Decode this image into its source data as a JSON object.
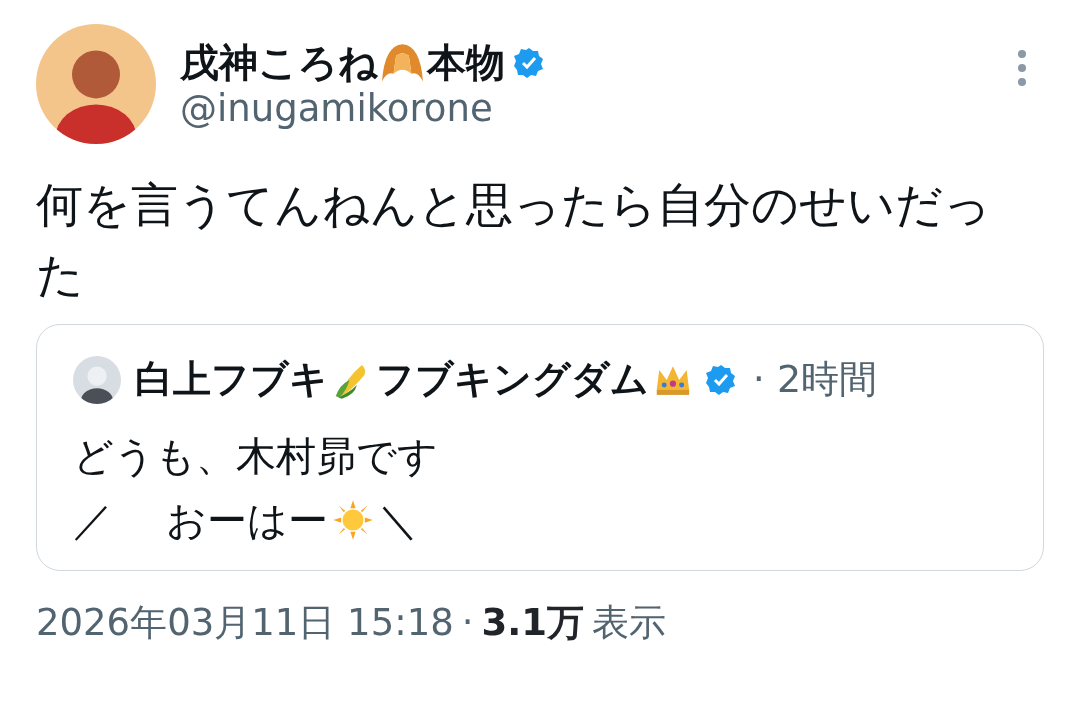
{
  "author": {
    "name": [
      {
        "kind": "text",
        "text": "戌神ころね"
      },
      {
        "kind": "croissant"
      },
      {
        "kind": "text",
        "text": "本物"
      }
    ],
    "verified": true,
    "handle": "@inugamikorone"
  },
  "tweet_text": "何を言うてんねんと思ったら自分のせいだった",
  "quote": {
    "name": [
      {
        "kind": "text",
        "text": "白上フブキ"
      },
      {
        "kind": "corn"
      },
      {
        "kind": "text",
        "text": "フブキングダム"
      },
      {
        "kind": "crown"
      }
    ],
    "verified": true,
    "time": "· 2時間",
    "lines": [
      [
        {
          "kind": "text",
          "text": "どうも、木村昴です"
        }
      ],
      [
        {
          "kind": "text",
          "text": "／　 おーはー"
        },
        {
          "kind": "sun"
        },
        {
          "kind": "text",
          "text": "＼"
        }
      ]
    ]
  },
  "footer": {
    "date": "2026年03月11日 15:18",
    "separator": "·",
    "views_count": "3.1万",
    "views_label": "表示"
  }
}
